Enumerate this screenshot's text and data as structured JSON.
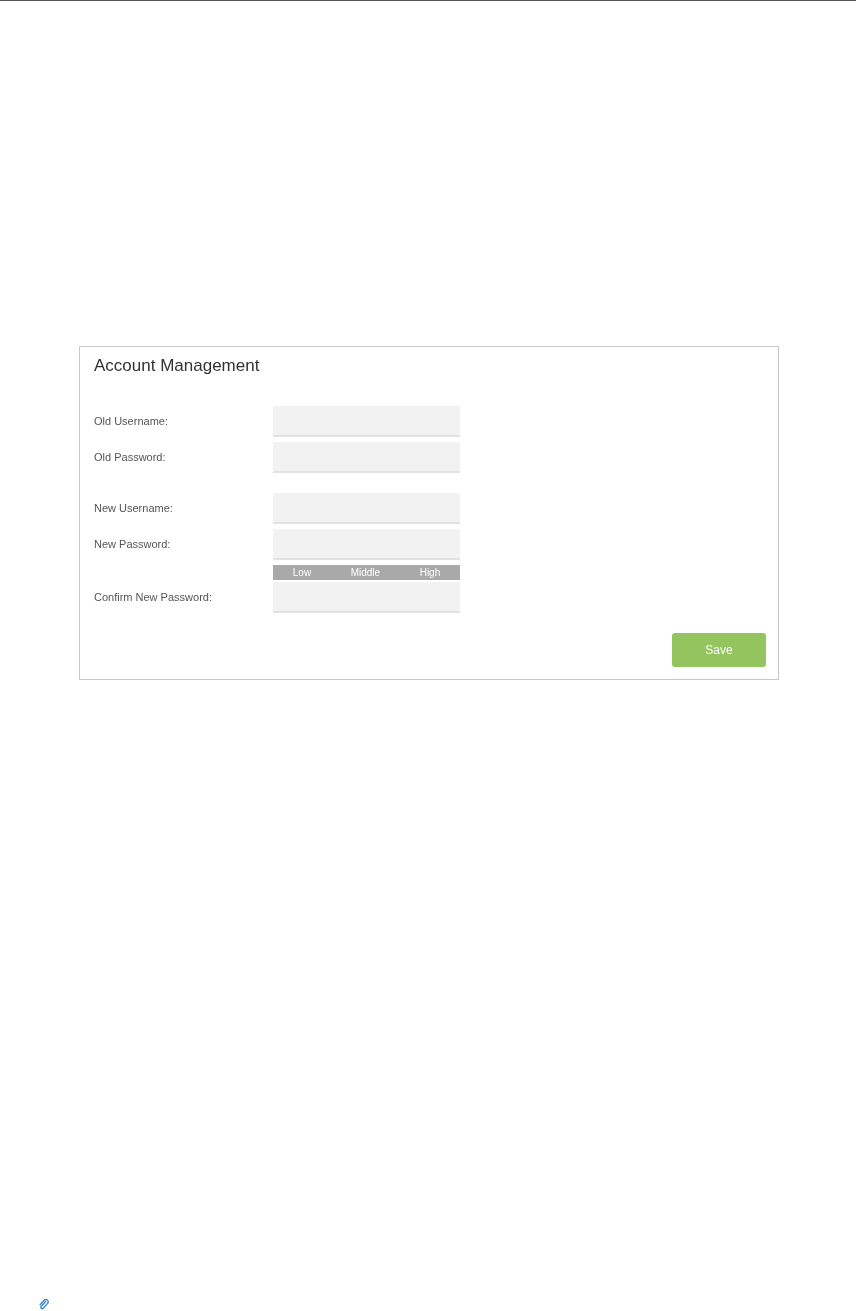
{
  "panel": {
    "title": "Account Management"
  },
  "sections": [
    {
      "fields": [
        {
          "label": "Old Username:"
        },
        {
          "label": "Old Password:"
        }
      ]
    },
    {
      "fields": [
        {
          "label": "New Username:"
        },
        {
          "label": "New Password:",
          "strength": [
            "Low",
            "Middle",
            "High"
          ]
        },
        {
          "label": "Confirm New Password:"
        }
      ]
    }
  ],
  "buttons": [
    "Save"
  ]
}
